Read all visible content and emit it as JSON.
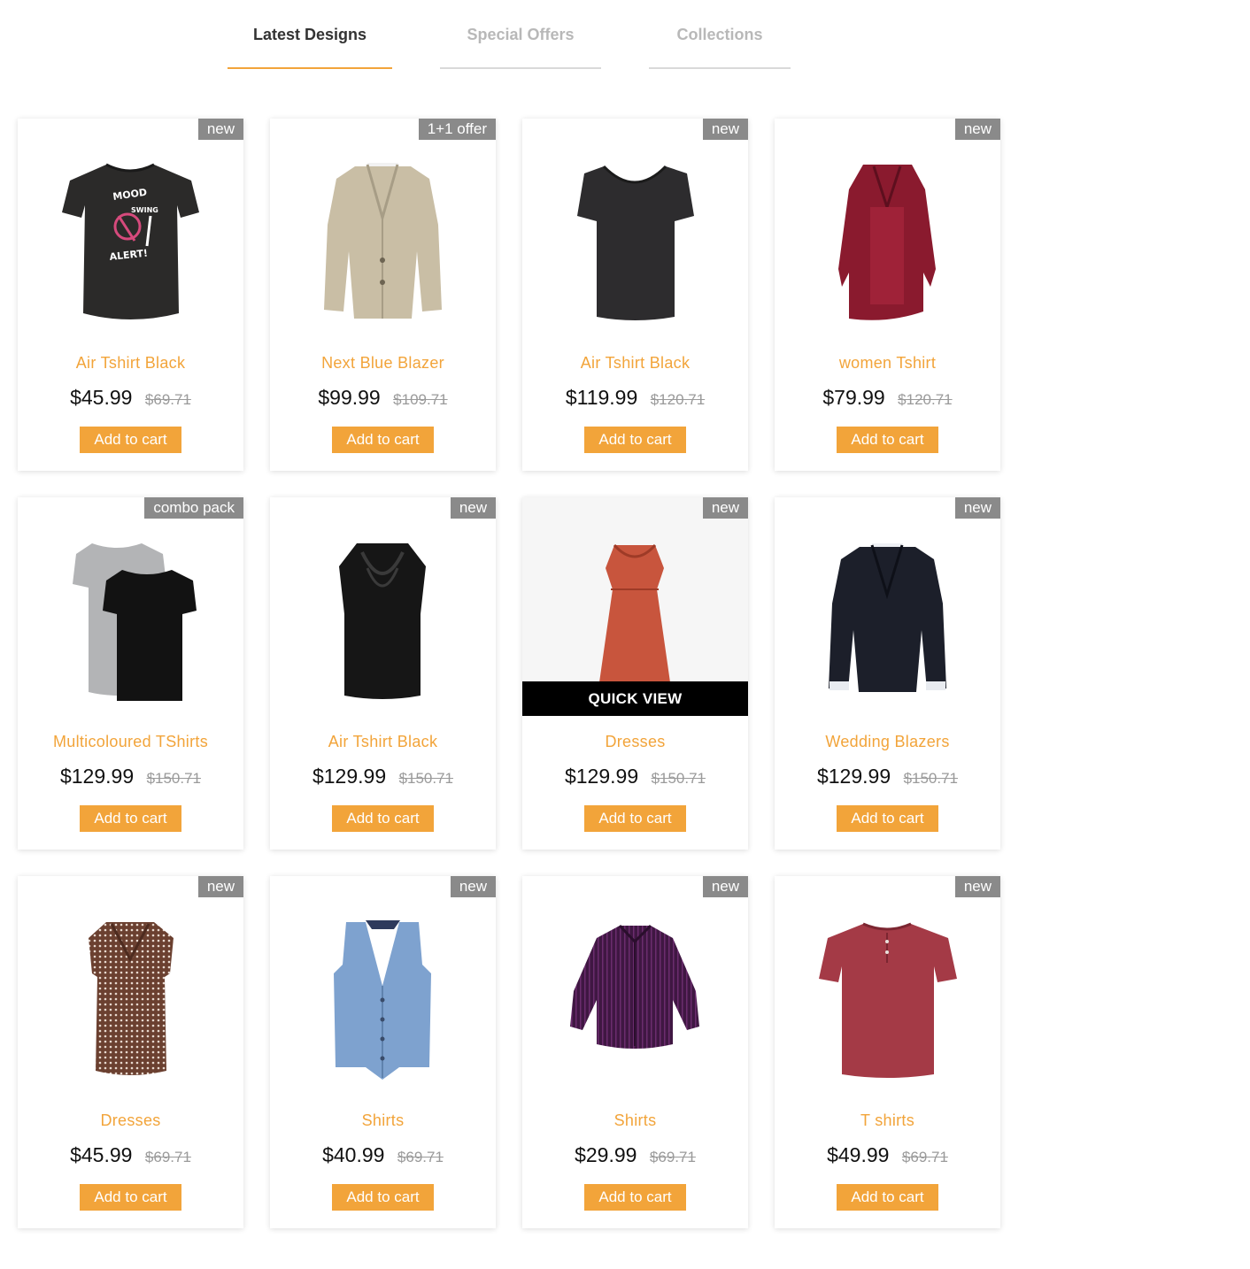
{
  "tabs": [
    {
      "label": "Latest Designs"
    },
    {
      "label": "Special Offers"
    },
    {
      "label": "Collections"
    }
  ],
  "colors": {
    "accent": "#f2a43a",
    "badge": "#8a8a8a",
    "quick_view_bg": "#000000"
  },
  "quick_view_label": "QUICK VIEW",
  "products": [
    {
      "name": "Air Tshirt Black",
      "price": "$45.99",
      "old_price": "$69.71",
      "badge": "new",
      "cta": "Add to cart",
      "image_icon": "black-graphic-tshirt-image"
    },
    {
      "name": "Next Blue Blazer",
      "price": "$99.99",
      "old_price": "$109.71",
      "badge": "1+1 offer",
      "cta": "Add to cart",
      "image_icon": "beige-blazer-image"
    },
    {
      "name": "Air Tshirt Black",
      "price": "$119.99",
      "old_price": "$120.71",
      "badge": "new",
      "cta": "Add to cart",
      "image_icon": "black-scoop-tshirt-image"
    },
    {
      "name": "women Tshirt",
      "price": "$79.99",
      "old_price": "$120.71",
      "badge": "new",
      "cta": "Add to cart",
      "image_icon": "maroon-cardigan-image"
    },
    {
      "name": "Multicoloured TShirts",
      "price": "$129.99",
      "old_price": "$150.71",
      "badge": "combo pack",
      "cta": "Add to cart",
      "image_icon": "two-tshirts-image"
    },
    {
      "name": "Air Tshirt Black",
      "price": "$129.99",
      "old_price": "$150.71",
      "badge": "new",
      "cta": "Add to cart",
      "image_icon": "black-cowl-top-image"
    },
    {
      "name": "Dresses",
      "price": "$129.99",
      "old_price": "$150.71",
      "badge": "new",
      "cta": "Add to cart",
      "image_icon": "rust-dress-image"
    },
    {
      "name": "Wedding Blazers",
      "price": "$129.99",
      "old_price": "$150.71",
      "badge": "new",
      "cta": "Add to cart",
      "image_icon": "black-blazer-image"
    },
    {
      "name": "Dresses",
      "price": "$45.99",
      "old_price": "$69.71",
      "badge": "new",
      "cta": "Add to cart",
      "image_icon": "patterned-blouse-image"
    },
    {
      "name": "Shirts",
      "price": "$40.99",
      "old_price": "$69.71",
      "badge": "new",
      "cta": "Add to cart",
      "image_icon": "blue-waistcoat-image"
    },
    {
      "name": "Shirts",
      "price": "$29.99",
      "old_price": "$69.71",
      "badge": "new",
      "cta": "Add to cart",
      "image_icon": "purple-striped-shirt-image"
    },
    {
      "name": "T shirts",
      "price": "$49.99",
      "old_price": "$69.71",
      "badge": "new",
      "cta": "Add to cart",
      "image_icon": "red-henley-tshirt-image"
    }
  ]
}
